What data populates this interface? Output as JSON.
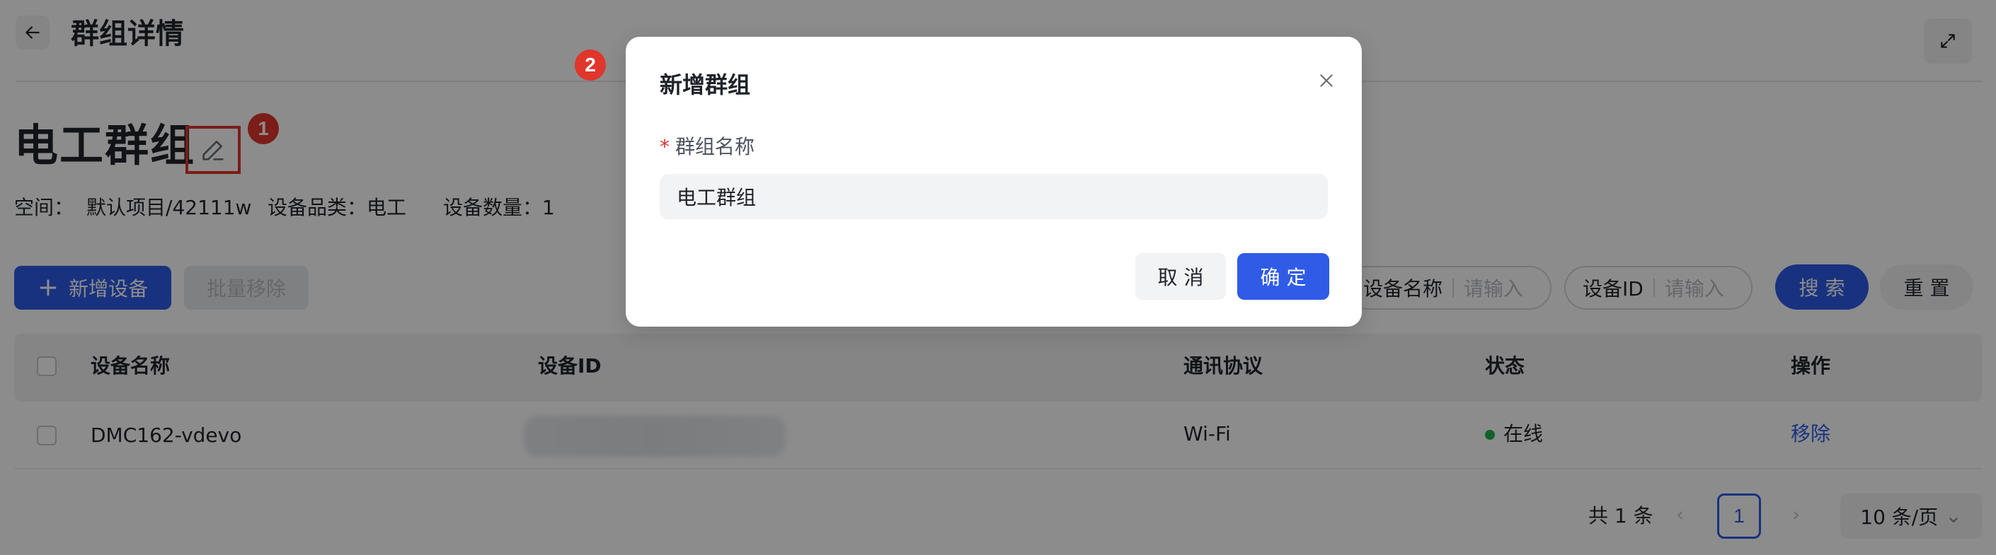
{
  "header": {
    "title": "群组详情"
  },
  "group": {
    "name": "电工群组",
    "space_label": "空间：",
    "space_value": "默认项目/42111w",
    "category_label": "设备品类：",
    "category_value": "电工",
    "count_label": "设备数量：",
    "count_value": "1"
  },
  "annotations": {
    "badge_1": "1",
    "badge_2": "2"
  },
  "toolbar": {
    "add_icon": "+",
    "add_label": "新增设备",
    "batch_remove_label": "批量移除",
    "search_name_label": "设备名称",
    "search_name_placeholder": "请输入",
    "search_id_label": "设备ID",
    "search_id_placeholder": "请输入",
    "search_button": "搜 索",
    "reset_button": "重 置"
  },
  "table": {
    "columns": [
      "设备名称",
      "设备ID",
      "通讯协议",
      "状态",
      "操作"
    ],
    "rows": [
      {
        "name": "DMC162-vdevo",
        "protocol": "Wi-Fi",
        "status": "在线",
        "action": "移除"
      }
    ]
  },
  "pagination": {
    "total": "共 1 条",
    "prev": "‹",
    "next": "›",
    "current": "1",
    "page_size": "10 条/页",
    "page_size_arrow": "⌄"
  },
  "modal": {
    "title": "新增群组",
    "required_mark": "*",
    "field_label": "群组名称",
    "field_value": "电工群组",
    "cancel": "取 消",
    "confirm": "确 定"
  },
  "colors": {
    "primary": "#2f5be7",
    "annotation_red": "#e0362c",
    "online_green": "#23b14d"
  },
  "icons": [
    "back-arrow-icon",
    "fullscreen-icon",
    "edit-icon",
    "plus-icon",
    "close-icon",
    "chevron-left-icon",
    "chevron-right-icon",
    "chevron-down-icon"
  ]
}
